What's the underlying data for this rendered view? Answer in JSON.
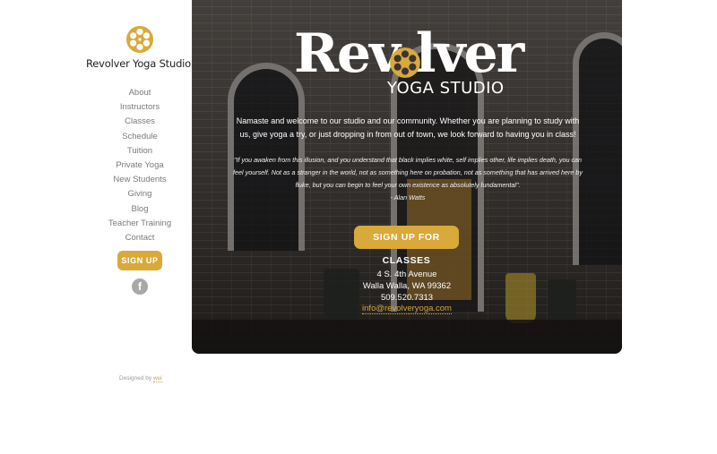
{
  "site": {
    "name": "Revolver Yoga Studio"
  },
  "nav": {
    "items": [
      "About",
      "Instructors",
      "Classes",
      "Schedule",
      "Tuition",
      "Private Yoga",
      "New Students",
      "Giving",
      "Blog",
      "Teacher Training",
      "Contact"
    ]
  },
  "sidebar": {
    "signup_label": "SIGN UP",
    "facebook_glyph": "f"
  },
  "footer": {
    "credit_prefix": "Designed by",
    "credit_link": "wui"
  },
  "hero": {
    "brand_word": "Rev lver",
    "brand_subtitle": "YOGA STUDIO",
    "welcome": "Namaste and welcome to our studio and our community. Whether you are planning to study with us, give yoga a try, or just dropping in from out of town, we look forward to having you in class!",
    "quote": "\"If you awaken from this illusion, and you understand that black implies white, self implies other, life implies death, you can feel yourself. Not as a stranger in the world, not as something here on probation, not as something that has arrived here by fluke, but you can begin to feel your own existence as absolutely fundamental\".",
    "quote_author": "- Alan Watts",
    "cta_label": "SIGN UP FOR CLASSES",
    "address_line1": "4 S. 4th Avenue",
    "address_line2": "Walla Walla, WA 99362",
    "phone": "509.520.7313",
    "email": "info@revolveryoga.com"
  },
  "colors": {
    "accent": "#d9a93a",
    "nav_text": "#7a7a7a",
    "facebook": "#a8a8a8"
  },
  "icons": {
    "logo": "film-reel-icon",
    "facebook": "facebook-icon"
  }
}
